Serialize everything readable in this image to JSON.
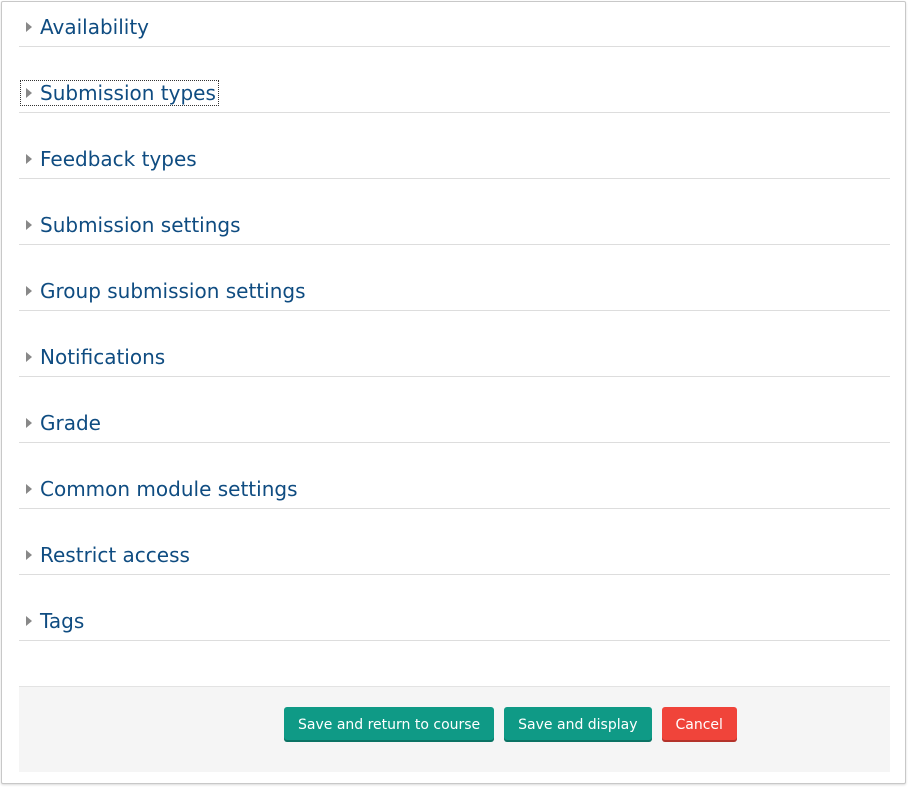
{
  "sections": [
    {
      "label": "Availability"
    },
    {
      "label": "Submission types"
    },
    {
      "label": "Feedback types"
    },
    {
      "label": "Submission settings"
    },
    {
      "label": "Group submission settings"
    },
    {
      "label": "Notifications"
    },
    {
      "label": "Grade"
    },
    {
      "label": "Common module settings"
    },
    {
      "label": "Restrict access"
    },
    {
      "label": "Tags"
    }
  ],
  "footer": {
    "save_return_label": "Save and return to course",
    "save_display_label": "Save and display",
    "cancel_label": "Cancel"
  },
  "colors": {
    "link": "#0f4c81",
    "primary_button": "#0f9a86",
    "cancel_button": "#f0443a"
  },
  "icons": {
    "collapsed": "triangle-right-icon"
  }
}
